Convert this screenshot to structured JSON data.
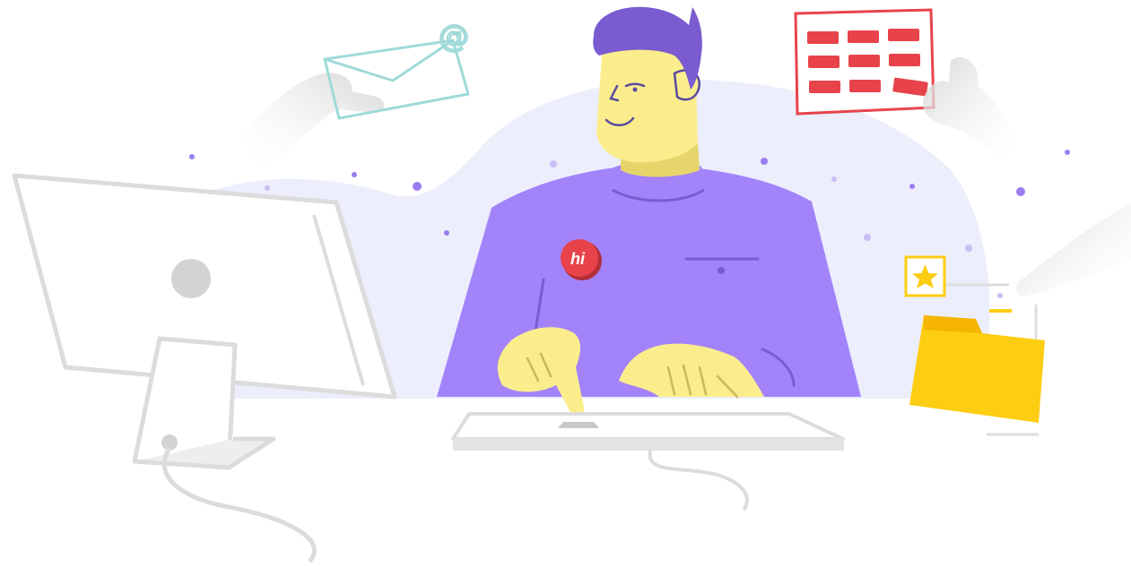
{
  "illustration": {
    "badge_text": "hi",
    "email_symbol": "@",
    "colors": {
      "purple_dark": "#7a5bd0",
      "purple_shirt": "#a383fa",
      "skin": "#fbed8c",
      "backdrop": "#eceefc",
      "red": "#e8434a",
      "yellow": "#fdcd12",
      "teal": "#9fdad9",
      "grey": "#dcdcdc"
    },
    "icons": [
      "envelope-icon",
      "calendar-icon",
      "folder-icon",
      "star-icon",
      "computer-monitor-icon",
      "keyboard-icon"
    ]
  }
}
